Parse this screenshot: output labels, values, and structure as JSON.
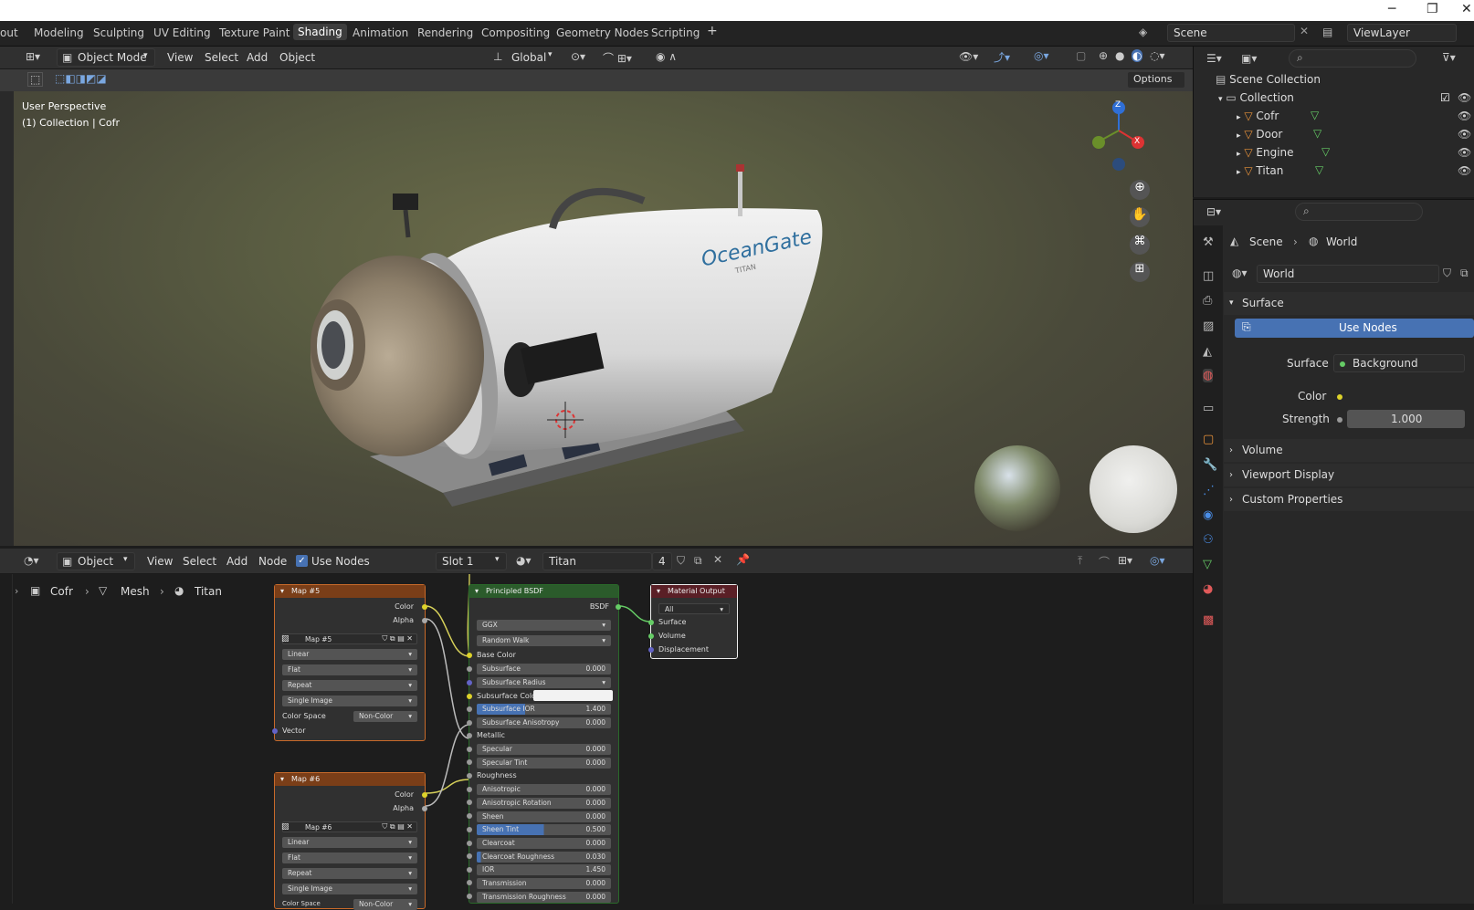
{
  "window": {
    "minimize": "─",
    "restore": "❐",
    "close": "✕"
  },
  "workspaces": [
    "out",
    "Modeling",
    "Sculpting",
    "UV Editing",
    "Texture Paint",
    "Shading",
    "Animation",
    "Rendering",
    "Compositing",
    "Geometry Nodes",
    "Scripting",
    "+"
  ],
  "scene": {
    "name": "Scene",
    "view_layer": "ViewLayer"
  },
  "viewport": {
    "mode": "Object Mode",
    "menus": [
      "View",
      "Select",
      "Add",
      "Object"
    ],
    "transform": "Global",
    "options": "Options",
    "overlay_title": "User Perspective",
    "overlay_sub": "(1) Collection | Cofr",
    "axes": {
      "z": "Z",
      "x": "X"
    },
    "logo_text": "OceanGate",
    "logo_sub": "TITAN"
  },
  "outliner": {
    "scene_collection": "Scene Collection",
    "collection": "Collection",
    "items": [
      "Cofr",
      "Door",
      "Engine",
      "Titan"
    ]
  },
  "properties": {
    "breadcrumb_scene": "Scene",
    "breadcrumb_world": "World",
    "world_name": "World",
    "surface_panel": "Surface",
    "use_nodes": "Use Nodes",
    "surface_label": "Surface",
    "surface_value": "Background",
    "color_label": "Color",
    "strength_label": "Strength",
    "strength_value": "1.000",
    "panels": [
      "Volume",
      "Viewport Display",
      "Custom Properties"
    ]
  },
  "node_editor": {
    "type": "Object",
    "menus": [
      "View",
      "Select",
      "Add",
      "Node"
    ],
    "use_nodes": "Use Nodes",
    "slot": "Slot 1",
    "material": "Titan",
    "users": "4",
    "breadcrumb": [
      "Cofr",
      "Mesh",
      "Titan"
    ]
  },
  "map5": {
    "title": "Map #5",
    "out_color": "Color",
    "out_alpha": "Alpha",
    "image": "Map #5",
    "interp": "Linear",
    "proj": "Flat",
    "ext": "Repeat",
    "source": "Single Image",
    "cs_label": "Color Space",
    "cs_value": "Non-Color",
    "vector": "Vector"
  },
  "map6": {
    "title": "Map #6",
    "out_color": "Color",
    "out_alpha": "Alpha",
    "image": "Map #6",
    "interp": "Linear",
    "proj": "Flat",
    "ext": "Repeat",
    "source": "Single Image",
    "cs_label": "Color Space",
    "cs_value": "Non-Color"
  },
  "bsdf": {
    "title": "Principled BSDF",
    "out": "BSDF",
    "dist": "GGX",
    "sss": "Random Walk",
    "base_color": "Base Color",
    "rows": [
      {
        "label": "Subsurface",
        "value": "0.000"
      },
      {
        "label": "Subsurface Radius",
        "value": ""
      },
      {
        "label": "Subsurface Color",
        "value": ""
      },
      {
        "label": "Subsurface IOR",
        "value": "1.400"
      },
      {
        "label": "Subsurface Anisotropy",
        "value": "0.000"
      },
      {
        "label": "Metallic",
        "value": ""
      },
      {
        "label": "Specular",
        "value": "0.000"
      },
      {
        "label": "Specular Tint",
        "value": "0.000"
      },
      {
        "label": "Roughness",
        "value": ""
      },
      {
        "label": "Anisotropic",
        "value": "0.000"
      },
      {
        "label": "Anisotropic Rotation",
        "value": "0.000"
      },
      {
        "label": "Sheen",
        "value": "0.000"
      },
      {
        "label": "Sheen Tint",
        "value": "0.500"
      },
      {
        "label": "Clearcoat",
        "value": "0.000"
      },
      {
        "label": "Clearcoat Roughness",
        "value": "0.030"
      },
      {
        "label": "IOR",
        "value": "1.450"
      },
      {
        "label": "Transmission",
        "value": "0.000"
      },
      {
        "label": "Transmission Roughness",
        "value": "0.000"
      }
    ]
  },
  "matout": {
    "title": "Material Output",
    "target": "All",
    "surface": "Surface",
    "volume": "Volume",
    "displacement": "Displacement"
  }
}
